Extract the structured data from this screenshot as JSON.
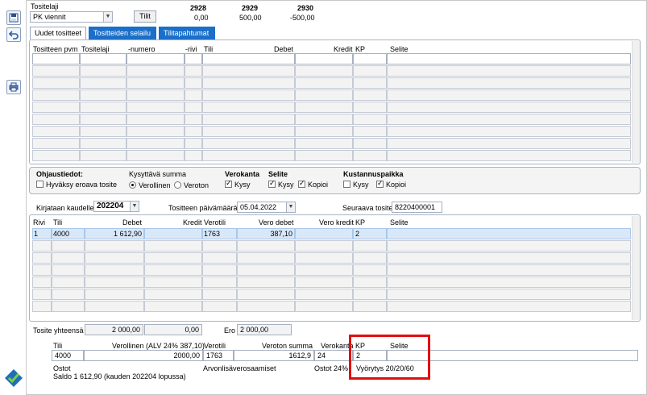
{
  "header": {
    "tositelaji_label": "Tositelaji",
    "tositelaji_value": "PK viennit",
    "tilit_button": "Tilit",
    "accounts": [
      {
        "account": "2928",
        "value": "0,00"
      },
      {
        "account": "2929",
        "value": "500,00"
      },
      {
        "account": "2930",
        "value": "-500,00"
      }
    ]
  },
  "tabs": [
    "Uudet tositteet",
    "Tositteiden selailu",
    "Tilitapahtumat"
  ],
  "top_grid": {
    "columns": [
      "Tositteen pvm",
      "Tositelaji",
      "-numero",
      "-rivi",
      "Tili",
      "Debet",
      "Kredit",
      "KP",
      "Selite"
    ]
  },
  "ohjaus": {
    "title": "Ohjaustiedot:",
    "hyvaksy_label": "Hyväksy eroava tosite",
    "kysyttava_label": "Kysyttävä summa",
    "verollinen_label": "Verollinen",
    "veroton_label": "Veroton",
    "verokanta_label": "Verokanta",
    "verokanta_kysy": "Kysy",
    "selite_label": "Selite",
    "selite_kysy": "Kysy",
    "selite_kopioi": "Kopioi",
    "kustannus_label": "Kustannuspaikka",
    "kustannus_kysy": "Kysy",
    "kustannus_kopioi": "Kopioi"
  },
  "kirjaus": {
    "kaudelle_label": "Kirjataan kaudelle",
    "kaudelle_value": "202204",
    "pvm_label": "Tositteen päivämäärä",
    "pvm_value": "05.04.2022",
    "seuraava_label": "Seuraava tosite",
    "seuraava_value": "8220400001"
  },
  "rows_grid": {
    "columns": [
      "Rivi",
      "Tili",
      "Debet",
      "Kredit",
      "Verotili",
      "Vero debet",
      "Vero kredit",
      "KP",
      "Selite"
    ],
    "rows": [
      {
        "rivi": "1",
        "tili": "4000",
        "debet": "1 612,90",
        "kredit": "",
        "verotili": "1763",
        "vero_debet": "387,10",
        "vero_kredit": "",
        "kp": "2",
        "selite": ""
      }
    ]
  },
  "totals": {
    "label": "Tosite yhteensä",
    "debet": "2 000,00",
    "kredit": "0,00",
    "ero_label": "Ero",
    "ero_value": "2 000,00"
  },
  "detail": {
    "tili_label": "Tili",
    "tili_value": "4000",
    "verollinen_label": "Verollinen (ALV 24% 387,10)",
    "verollinen_value": "2000,00",
    "verotili_label": "Verotili",
    "verotili_value": "1763",
    "veroton_label": "Veroton summa",
    "veroton_value": "1612,9",
    "verokanta_label": "Verokanta",
    "verokanta_value": "24",
    "kp_label": "KP",
    "kp_value": "2",
    "selite_label": "Selite",
    "selite_value": "",
    "ostot_label": "Ostot",
    "arvonlisa_label": "Arvonlisäverosaamiset",
    "ostot24_label": "Ostot 24%",
    "vyorytys_label": "Vyörytys 20/20/60",
    "saldo_text": "Saldo 1 612,90  (kauden 202204 lopussa)"
  },
  "colors": {
    "highlight": "#e01010",
    "tab_active_bg": "#1b6fc8",
    "selected_row": "#d9e8f8"
  }
}
